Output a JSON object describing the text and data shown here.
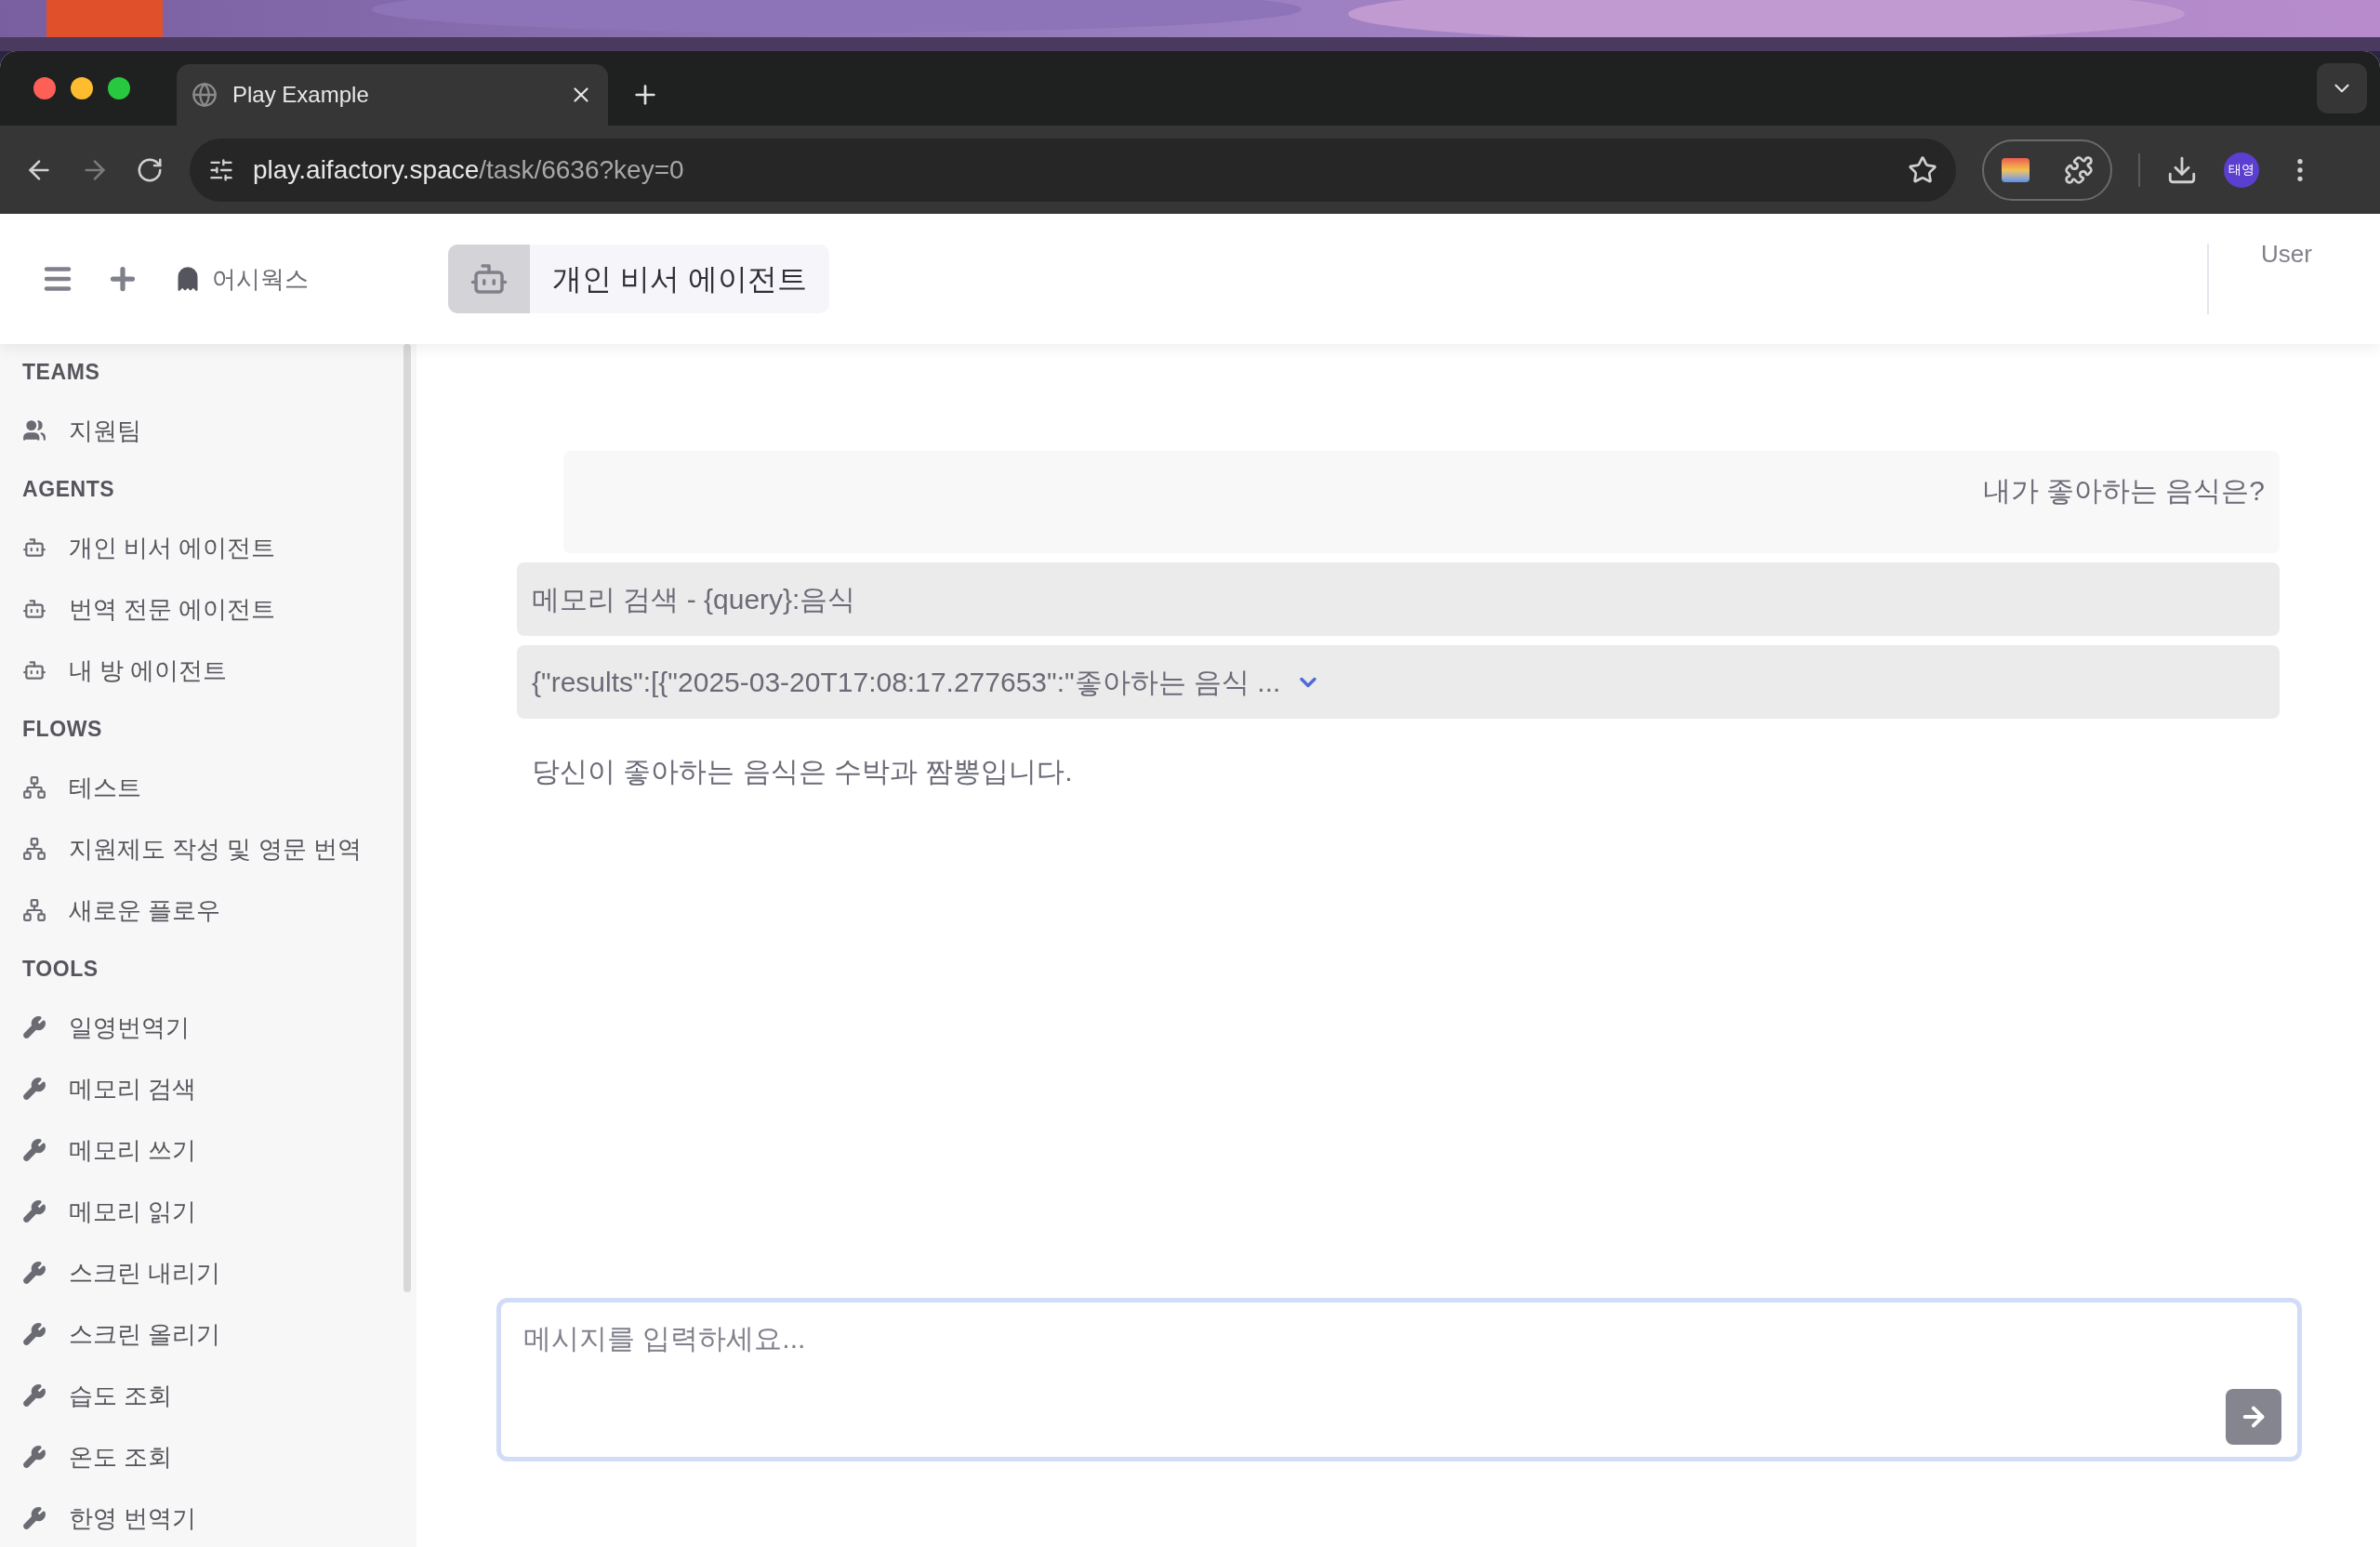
{
  "browser": {
    "tab": {
      "title": "Play Example"
    },
    "url": {
      "host": "play.aifactory.space",
      "path": "/task/6636?key=0"
    },
    "profile": "태영"
  },
  "header": {
    "workspace": "어시웍스",
    "agent_title": "개인 비서 에이전트",
    "user": "User"
  },
  "sidebar": [
    {
      "heading": "TEAMS",
      "kind": "team",
      "items": [
        {
          "label": "지원팀"
        }
      ]
    },
    {
      "heading": "AGENTS",
      "kind": "agent",
      "items": [
        {
          "label": "개인 비서 에이전트"
        },
        {
          "label": "번역 전문 에이전트"
        },
        {
          "label": "내 방 에이전트"
        }
      ]
    },
    {
      "heading": "FLOWS",
      "kind": "flow",
      "items": [
        {
          "label": "테스트"
        },
        {
          "label": "지원제도 작성 및 영문 번역"
        },
        {
          "label": "새로운 플로우"
        }
      ]
    },
    {
      "heading": "TOOLS",
      "kind": "tool",
      "items": [
        {
          "label": "일영번역기"
        },
        {
          "label": "메모리 검색"
        },
        {
          "label": "메모리 쓰기"
        },
        {
          "label": "메모리 읽기"
        },
        {
          "label": "스크린 내리기"
        },
        {
          "label": "스크린 올리기"
        },
        {
          "label": "습도 조회"
        },
        {
          "label": "온도 조회"
        },
        {
          "label": "한영 번역기"
        }
      ]
    }
  ],
  "messages": [
    {
      "kind": "user",
      "text": "내가 좋아하는 음식은?"
    },
    {
      "kind": "tool_call",
      "text": "메모리 검색 - {query}:음식"
    },
    {
      "kind": "tool_result",
      "text": "{\"results\":[{\"2025-03-20T17:08:17.277653\":\"좋아하는 음식 ...",
      "expanded": false
    },
    {
      "kind": "assistant",
      "text": "당신이 좋아하는 음식은 수박과 짬뽕입니다."
    }
  ],
  "composer": {
    "placeholder": "메시지를 입력하세요..."
  }
}
